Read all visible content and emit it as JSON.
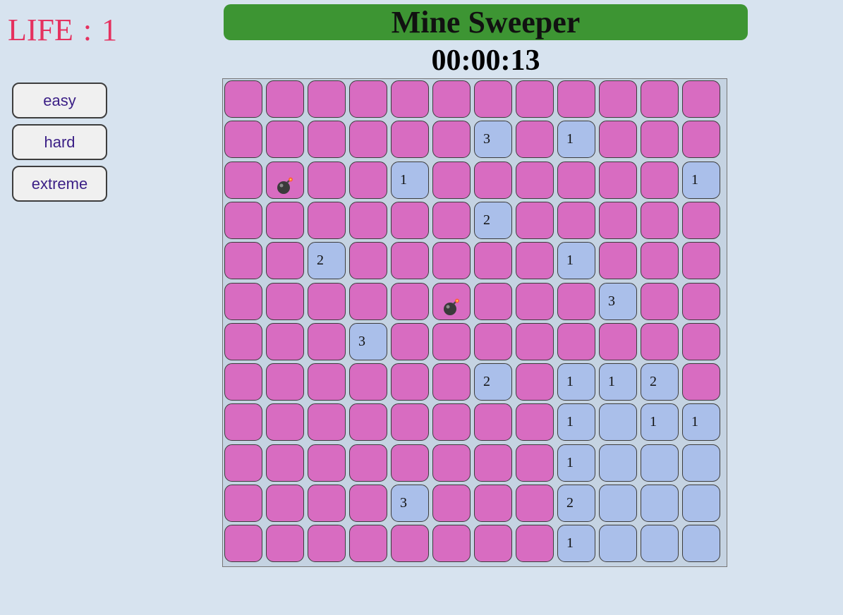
{
  "life": {
    "label": "LIFE",
    "separator": ":",
    "value": "1"
  },
  "levels": [
    {
      "id": "easy",
      "label": "easy"
    },
    {
      "id": "hard",
      "label": "hard"
    },
    {
      "id": "extreme",
      "label": "extreme"
    }
  ],
  "header": {
    "title": "Mine Sweeper"
  },
  "timer": {
    "value": "00:00:13"
  },
  "colors": {
    "hidden_cell": "#d86cc1",
    "open_cell": "#aabfea",
    "header_bar": "#3d9533",
    "life_text": "#e5315f",
    "background": "#d7e3ef"
  },
  "board": {
    "rows": 12,
    "cols": 12,
    "legend": {
      "H": "hidden",
      "O": "opened-empty",
      "B": "bomb",
      "1-8": "opened-number"
    },
    "cells": [
      [
        "H",
        "H",
        "H",
        "H",
        "H",
        "H",
        "H",
        "H",
        "H",
        "H",
        "H",
        "H"
      ],
      [
        "H",
        "H",
        "H",
        "H",
        "H",
        "H",
        "3",
        "H",
        "1",
        "H",
        "H",
        "H"
      ],
      [
        "H",
        "B",
        "H",
        "H",
        "1",
        "H",
        "H",
        "H",
        "H",
        "H",
        "H",
        "1"
      ],
      [
        "H",
        "H",
        "H",
        "H",
        "H",
        "H",
        "2",
        "H",
        "H",
        "H",
        "H",
        "H"
      ],
      [
        "H",
        "H",
        "2",
        "H",
        "H",
        "H",
        "H",
        "H",
        "1",
        "H",
        "H",
        "H"
      ],
      [
        "H",
        "H",
        "H",
        "H",
        "H",
        "B",
        "H",
        "H",
        "H",
        "3",
        "H",
        "H"
      ],
      [
        "H",
        "H",
        "H",
        "3",
        "H",
        "H",
        "H",
        "H",
        "H",
        "H",
        "H",
        "H"
      ],
      [
        "H",
        "H",
        "H",
        "H",
        "H",
        "H",
        "2",
        "H",
        "1",
        "1",
        "2",
        "H"
      ],
      [
        "H",
        "H",
        "H",
        "H",
        "H",
        "H",
        "H",
        "H",
        "1",
        "O",
        "1",
        "1"
      ],
      [
        "H",
        "H",
        "H",
        "H",
        "H",
        "H",
        "H",
        "H",
        "1",
        "O",
        "O",
        "O"
      ],
      [
        "H",
        "H",
        "H",
        "H",
        "3",
        "H",
        "H",
        "H",
        "2",
        "O",
        "O",
        "O"
      ],
      [
        "H",
        "H",
        "H",
        "H",
        "H",
        "H",
        "H",
        "H",
        "1",
        "O",
        "O",
        "O"
      ]
    ]
  }
}
